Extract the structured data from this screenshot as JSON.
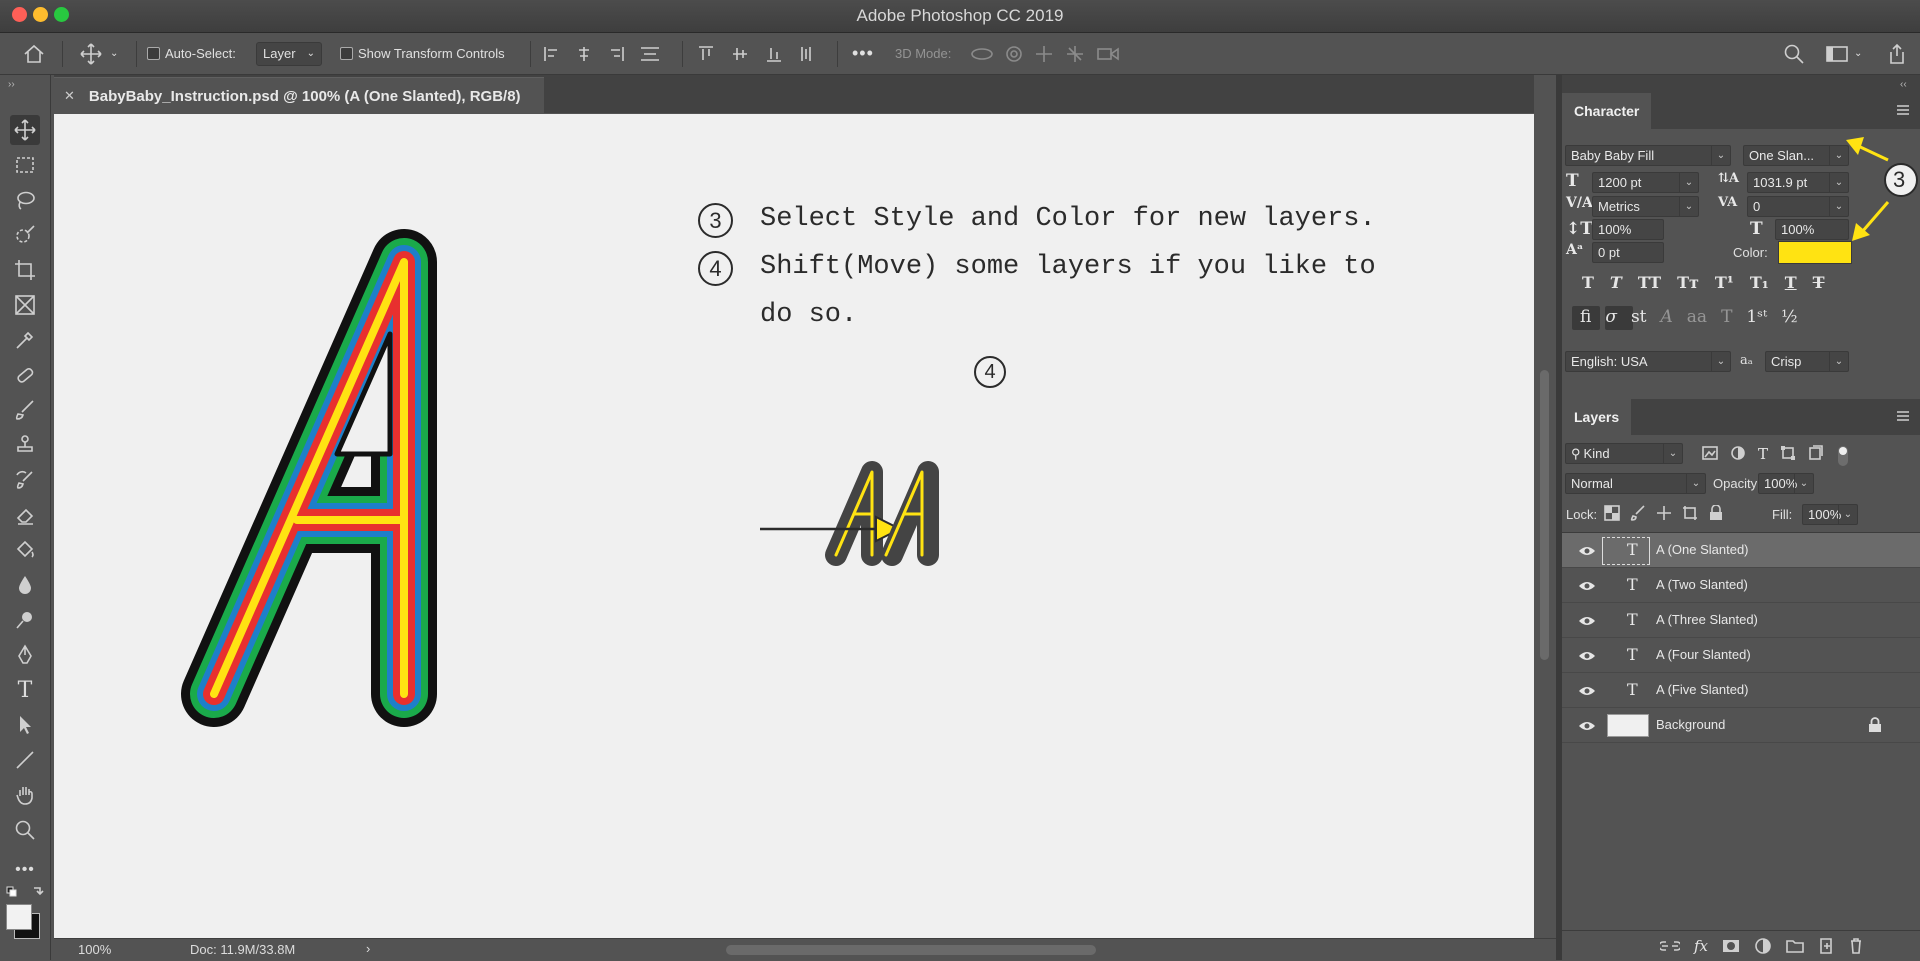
{
  "app": {
    "title": "Adobe Photoshop CC 2019"
  },
  "options_bar": {
    "auto_select_label": "Auto-Select:",
    "auto_select_value": "Layer",
    "show_transform_label": "Show Transform Controls",
    "mode_3d_label": "3D Mode:"
  },
  "document": {
    "tab_title": "BabyBaby_Instruction.psd @ 100% (A (One Slanted), RGB/8)"
  },
  "canvas": {
    "step3_number": "3",
    "step3_text": "Select Style and Color for new layers.",
    "step4_number": "4",
    "step4_text_line1": "Shift(Move) some layers if you like to",
    "step4_text_line2": "do so.",
    "arrow_number": "4",
    "callout_number": "3",
    "colors": {
      "black": "#111111",
      "green": "#1aaa4a",
      "blue": "#1e7fc9",
      "red": "#e8302f",
      "yellow": "#ffe312",
      "charcoal": "#444444"
    }
  },
  "status": {
    "zoom": "100%",
    "doc_size": "Doc: 11.9M/33.8M"
  },
  "character_panel": {
    "tab": "Character",
    "font_family": "Baby Baby Fill",
    "font_style": "One Slan...",
    "font_size": "1200 pt",
    "leading": "1031.9 pt",
    "kerning": "Metrics",
    "tracking": "0",
    "vertical_scale": "100%",
    "horizontal_scale": "100%",
    "baseline_shift": "0 pt",
    "color_label": "Color:",
    "color_value": "#ffe312",
    "language": "English: USA",
    "aa_label": "aa",
    "antialias": "Crisp"
  },
  "layers_panel": {
    "tab": "Layers",
    "filter_kind": "Kind",
    "blend_mode": "Normal",
    "opacity_label": "Opacity:",
    "opacity_value": "100%",
    "lock_label": "Lock:",
    "fill_label": "Fill:",
    "fill_value": "100%",
    "layers": [
      {
        "name": "A (One Slanted)",
        "type": "text",
        "selected": true
      },
      {
        "name": "A (Two Slanted)",
        "type": "text"
      },
      {
        "name": "A (Three Slanted)",
        "type": "text"
      },
      {
        "name": "A (Four Slanted)",
        "type": "text"
      },
      {
        "name": "A (Five Slanted)",
        "type": "text"
      },
      {
        "name": "Background",
        "type": "image",
        "locked": true
      }
    ]
  }
}
